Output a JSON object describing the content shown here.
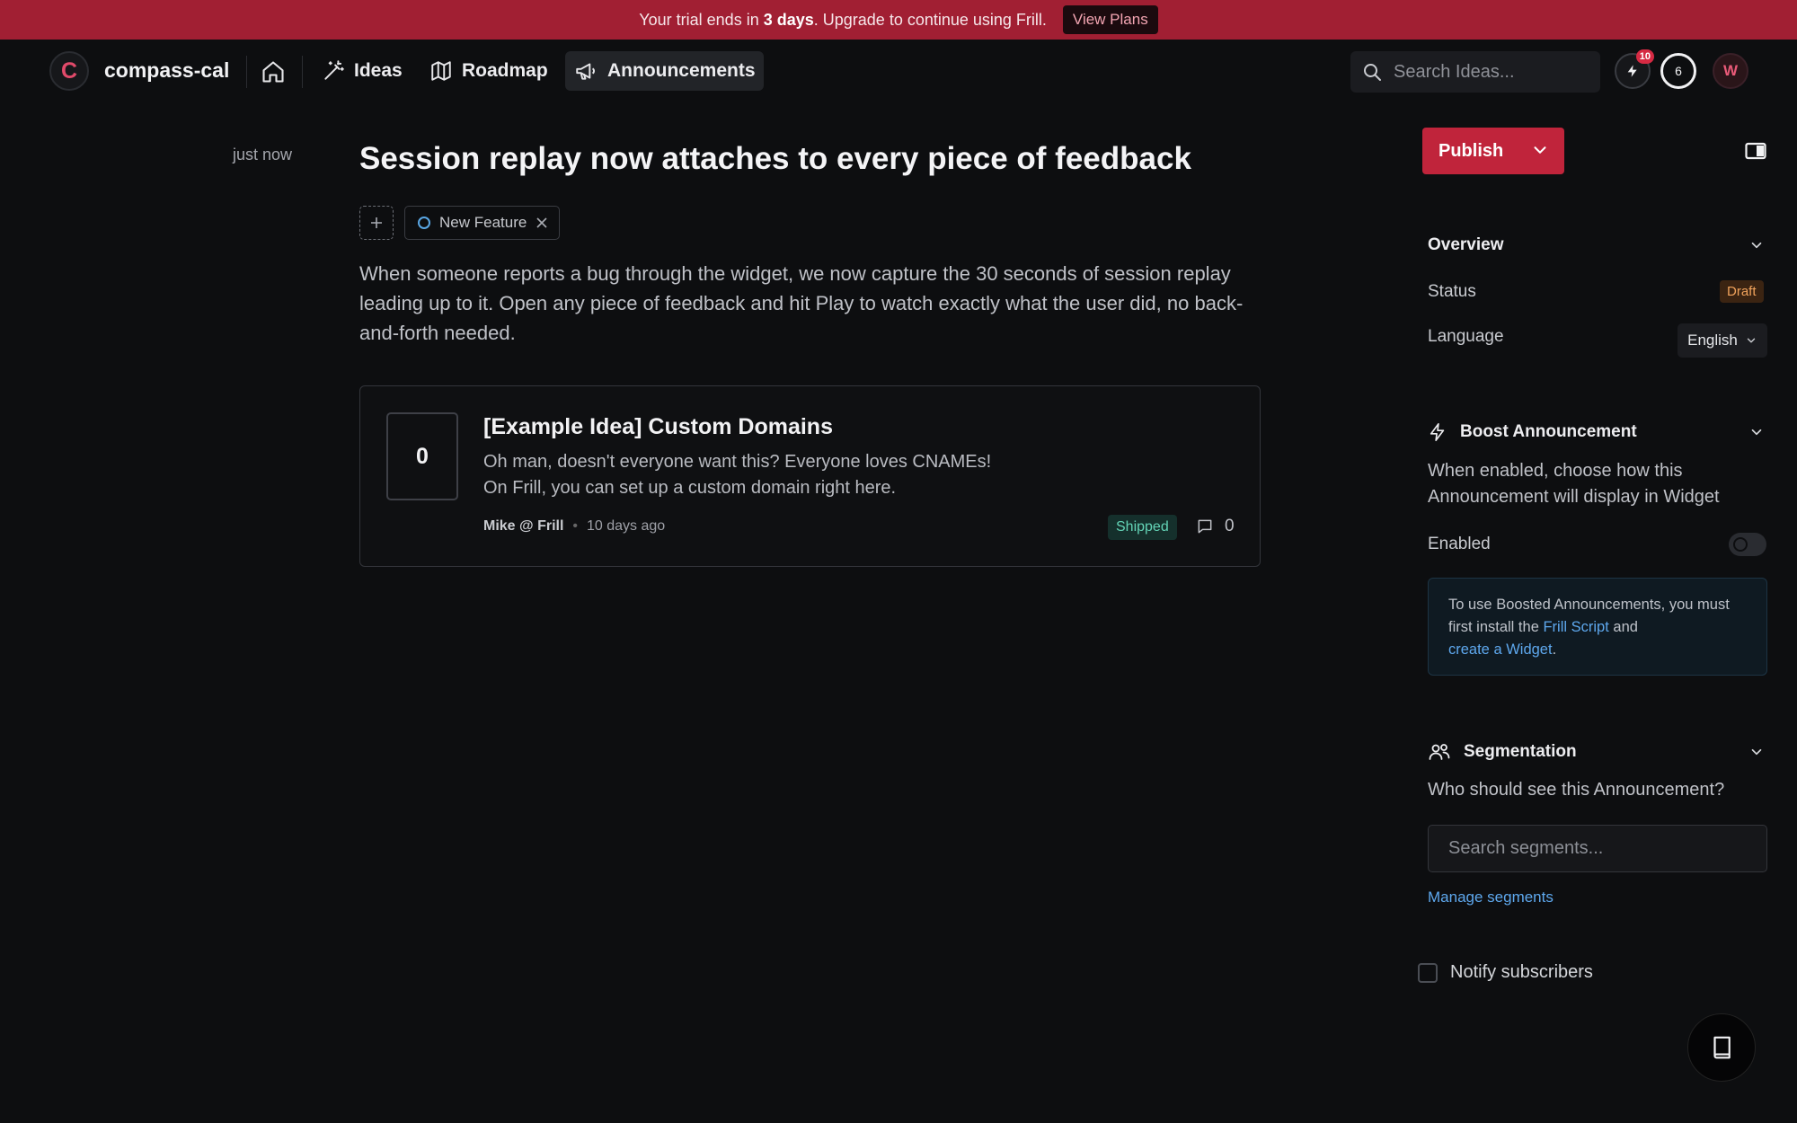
{
  "banner": {
    "text_before": "Your trial ends in",
    "days": "3 days",
    "text_after": ". Upgrade to continue using Frill.",
    "button": "View Plans"
  },
  "nav": {
    "org_initial": "C",
    "org_name": "compass-cal",
    "items": [
      {
        "label": "Ideas",
        "icon": "magic-wand-icon"
      },
      {
        "label": "Roadmap",
        "icon": "map-icon"
      },
      {
        "label": "Announcements",
        "icon": "megaphone-icon",
        "active": true
      }
    ],
    "search_placeholder": "Search Ideas...",
    "notification_count": "10",
    "progress_value": "6",
    "user_initial": "W"
  },
  "post": {
    "timestamp": "just now",
    "title": "Session replay now attaches to every piece of feedback",
    "tag": "New Feature",
    "body": "When someone reports a bug through the widget, we now capture the 30 seconds of session replay leading up to it. Open any piece of feedback and hit Play to watch exactly what the user did, no back-and-forth needed."
  },
  "idea_card": {
    "votes": "0",
    "title": "[Example Idea] Custom Domains",
    "desc_line1": "Oh man, doesn't everyone want this? Everyone loves CNAMEs!",
    "desc_line2": "On Frill, you can set up a custom domain right here.",
    "author": "Mike @ Frill",
    "time": "10 days ago",
    "status": "Shipped",
    "comment_count": "0"
  },
  "sidebar": {
    "publish_label": "Publish",
    "overview": {
      "title": "Overview",
      "status_label": "Status",
      "status_value": "Draft",
      "language_label": "Language",
      "language_value": "English"
    },
    "boost": {
      "title": "Boost Announcement",
      "description": "When enabled, choose how this Announcement will display in Widget",
      "enabled_label": "Enabled",
      "enabled": false,
      "info_part1": "To use Boosted Announcements, you must first install the",
      "info_link1": "Frill Script",
      "info_part2": "and",
      "info_link2": "create a Widget",
      "info_part3": "."
    },
    "segmentation": {
      "title": "Segmentation",
      "question": "Who should see this Announcement?",
      "search_placeholder": "Search segments...",
      "manage_link": "Manage segments"
    },
    "notify_label": "Notify subscribers",
    "notify_checked": false
  },
  "colors": {
    "brand": "#c0243b",
    "banner": "#a11f33",
    "background": "#0d0e10",
    "link": "#5ea8ee",
    "shipped": "#63d3b6",
    "draft": "#f1a35c"
  }
}
